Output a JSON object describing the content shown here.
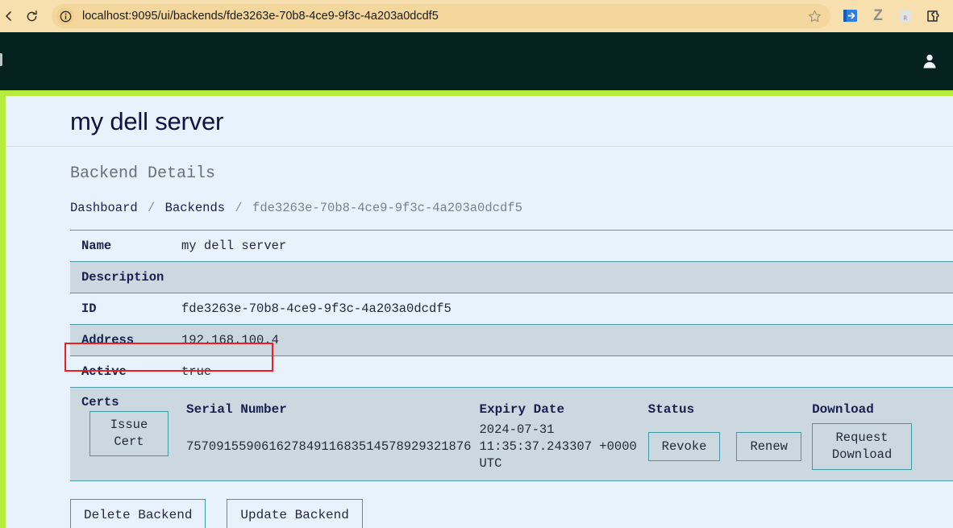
{
  "browser": {
    "url_host": "localhost:9095",
    "url_path": "/ui/backends/fde3263e-70b8-4ce9-9f3c-4a203a0dcdf5",
    "url_full": "localhost:9095/ui/backends/fde3263e-70b8-4ce9-9f3c-4a203a0dcdf5",
    "reload_icon": "reload-icon",
    "site_info_icon": "site-info-icon",
    "bookmark_icon": "star-icon",
    "back_icon": "back-arrow-icon",
    "extensions": [
      {
        "name": "extension-icon-bitwarden",
        "glyph": "➡"
      },
      {
        "name": "extension-icon-z",
        "glyph": "Z"
      },
      {
        "name": "extension-icon-ublock",
        "glyph": "ʀ"
      },
      {
        "name": "extension-icon-puzzle",
        "glyph": "⧉"
      }
    ]
  },
  "navbar": {
    "user_icon": "user-avatar-icon"
  },
  "page": {
    "title": "my dell server",
    "subtitle": "Backend Details",
    "accent_green": "#b7ec3e",
    "accent_teal": "#3f9aa6",
    "highlight_color": "#f01e1e"
  },
  "breadcrumb": {
    "items": [
      {
        "label": "Dashboard",
        "link": true
      },
      {
        "label": "Backends",
        "link": true
      },
      {
        "label": "fde3263e-70b8-4ce9-9f3c-4a203a0dcdf5",
        "link": false
      }
    ],
    "separator": "/"
  },
  "details": {
    "rows": [
      {
        "label": "Name",
        "value": "my dell server"
      },
      {
        "label": "Description",
        "value": ""
      },
      {
        "label": "ID",
        "value": "fde3263e-70b8-4ce9-9f3c-4a203a0dcdf5"
      },
      {
        "label": "Address",
        "value": "192.168.100.4"
      },
      {
        "label": "Active",
        "value": "true"
      }
    ]
  },
  "certs": {
    "label": "Certs",
    "issue_button": "Issue\nCert",
    "columns": {
      "serial": "Serial Number",
      "expiry": "Expiry Date",
      "status": "Status",
      "download": "Download"
    },
    "row": {
      "serial_number": "75709155906162784911683514578929321876",
      "expiry_date": "2024-07-31 11:35:37.243307 +0000 UTC",
      "revoke_button": "Revoke",
      "renew_button": "Renew",
      "download_button": "Request\nDownload"
    }
  },
  "actions": {
    "delete_backend": "Delete Backend",
    "update_backend": "Update Backend"
  }
}
